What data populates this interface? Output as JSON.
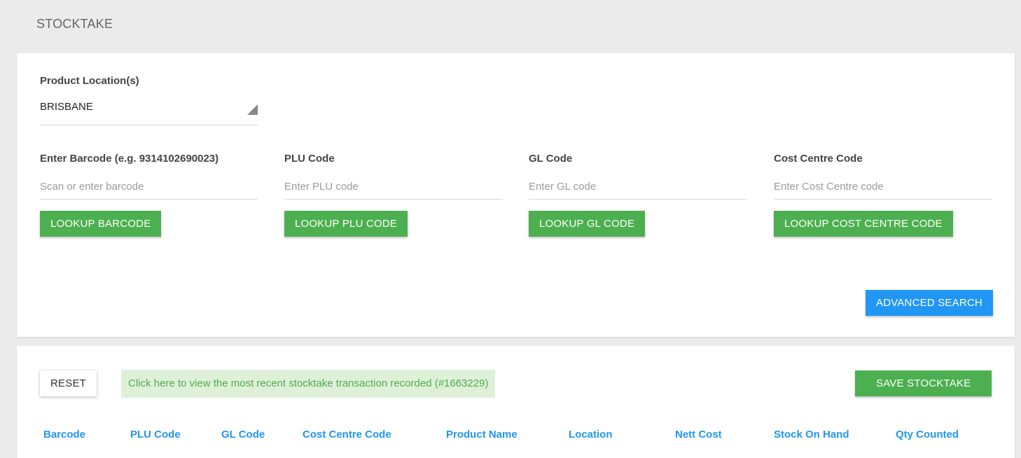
{
  "page": {
    "title": "STOCKTAKE"
  },
  "search": {
    "location_label": "Product Location(s)",
    "location_value": "BRISBANE",
    "barcode": {
      "label": "Enter Barcode (e.g. 9314102690023)",
      "placeholder": "Scan or enter barcode",
      "button": "LOOKUP BARCODE"
    },
    "plu": {
      "label": "PLU Code",
      "placeholder": "Enter PLU code",
      "button": "LOOKUP PLU CODE"
    },
    "gl": {
      "label": "GL Code",
      "placeholder": "Enter GL code",
      "button": "LOOKUP GL CODE"
    },
    "cost_centre": {
      "label": "Cost Centre Code",
      "placeholder": "Enter Cost Centre code",
      "button": "LOOKUP COST CENTRE CODE"
    },
    "advanced_button": "ADVANCED SEARCH"
  },
  "results": {
    "reset_button": "RESET",
    "recent_link": "Click here to view the most recent stocktake transaction recorded (#1663229)",
    "save_button": "SAVE STOCKTAKE",
    "columns": [
      "Barcode",
      "PLU Code",
      "GL Code",
      "Cost Centre Code",
      "Product Name",
      "Location",
      "Nett Cost",
      "Stock On Hand",
      "Qty Counted"
    ]
  },
  "colors": {
    "primary_green": "#4caf50",
    "primary_blue": "#2196f3",
    "link_bg": "#dff0d8",
    "page_bg": "#ebebeb"
  },
  "icons": {
    "select_arrow": "dropdown-triangle-icon"
  }
}
